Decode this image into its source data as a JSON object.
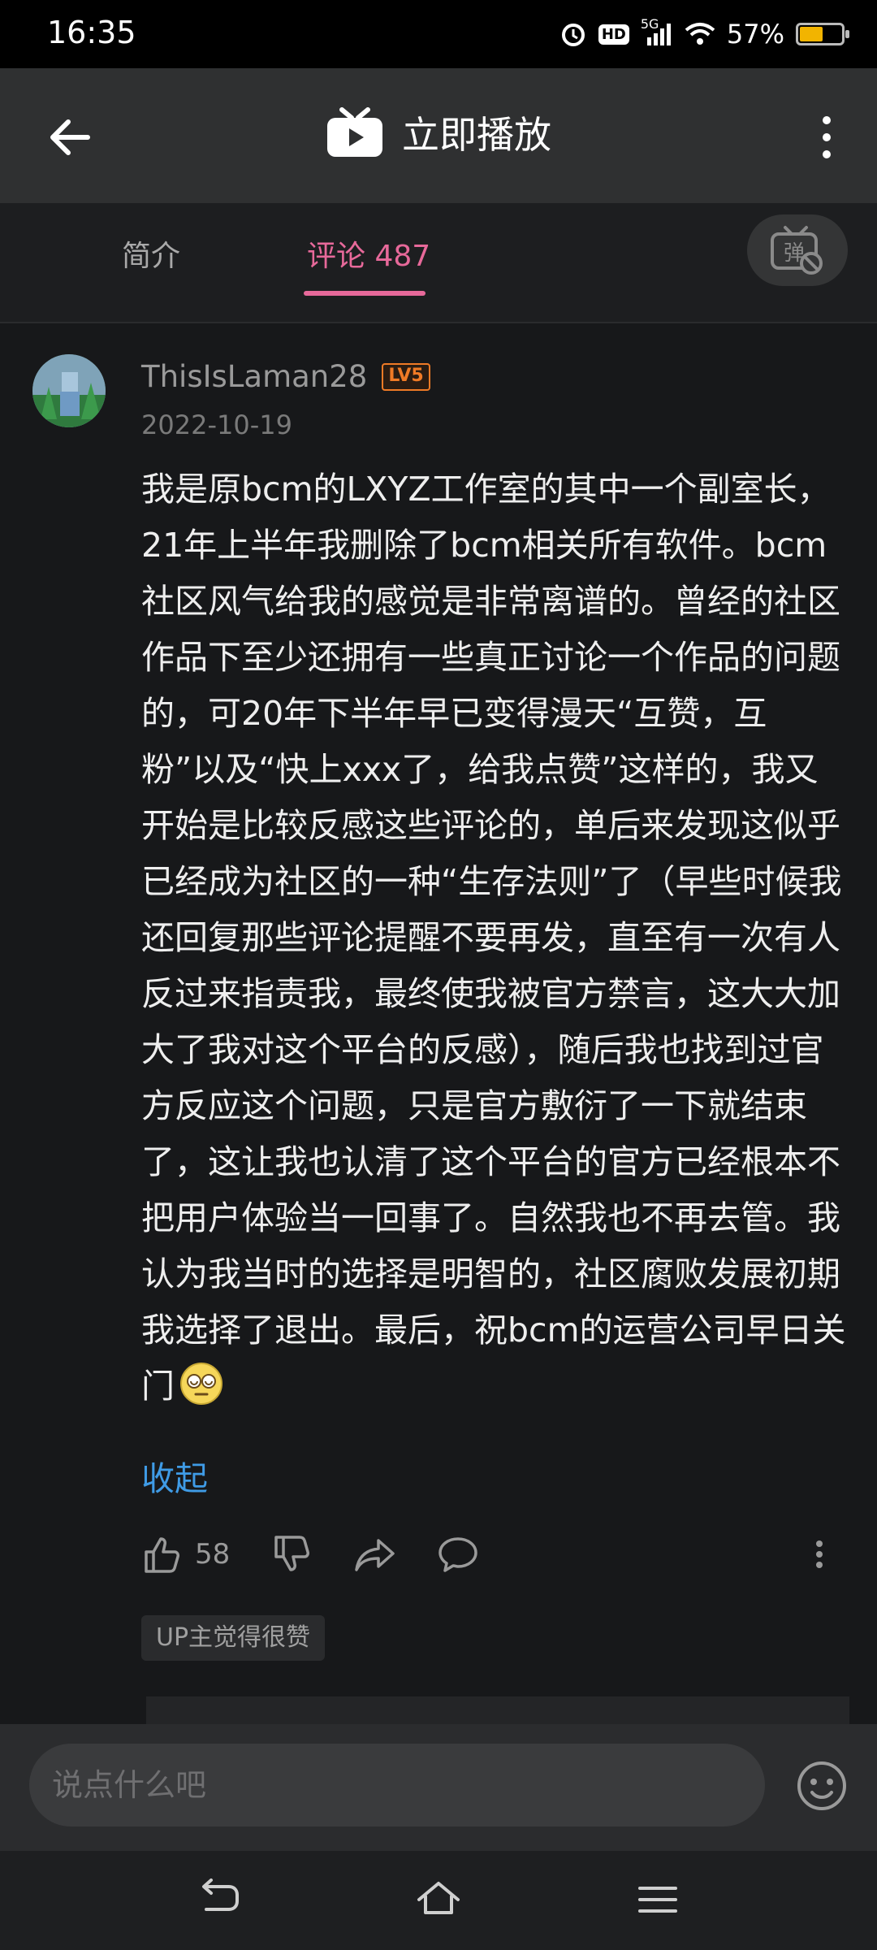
{
  "status_bar": {
    "time": "16:35",
    "network": "5G",
    "hd_label": "HD",
    "battery_text": "57%",
    "battery_level": 0.57
  },
  "header": {
    "title": "立即播放",
    "icons": {
      "back": "arrow-left-icon",
      "tv": "tv-icon",
      "more": "more-vertical-icon"
    }
  },
  "tabs": {
    "intro_label": "简介",
    "comments_label": "评论 487",
    "danmaku_label": "弹"
  },
  "comment": {
    "username": "ThisIsLaman28",
    "level": "LV5",
    "date": "2022-10-19",
    "body": "我是原bcm的LXYZ工作室的其中一个副室长，21年上半年我删除了bcm相关所有软件。bcm社区风气给我的感觉是非常离谱的。曾经的社区作品下至少还拥有一些真正讨论一个作品的问题的，可20年下半年早已变得漫天“互赞，互粉”以及“快上xxx了，给我点赞”这样的，我又开始是比较反感这些评论的，单后来发现这似乎已经成为社区的一种“生存法则”了（早些时候我还回复那些评论提醒不要再发，直至有一次有人反过来指责我，最终使我被官方禁言，这大大加大了我对这个平台的反感），随后我也找到过官方反应这个问题，只是官方敷衍了一下就结束了，这让我也认清了这个平台的官方已经根本不把用户体验当一回事了。自然我也不再去管。我认为我当时的选择是明智的，社区腐败发展初期我选择了退出。最后，祝bcm的运营公司早日关门",
    "collapse_label": "收起",
    "like_count": "58",
    "up_liked_label": "UP主觉得很赞"
  },
  "input": {
    "placeholder": "说点什么吧"
  },
  "colors": {
    "accent_pink": "#e7699a",
    "link_blue": "#3f9be6",
    "level_orange": "#f07b26",
    "background": "#17181a"
  }
}
